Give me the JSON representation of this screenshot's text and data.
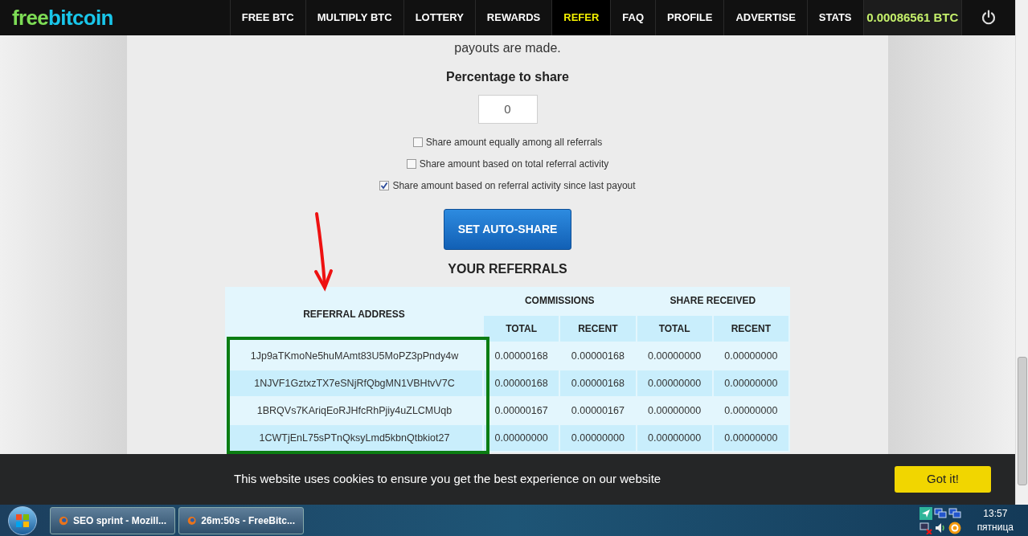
{
  "logo": {
    "part_1": "free",
    "part_2": "bitcoin"
  },
  "nav": [
    {
      "label": "FREE BTC",
      "selected": false
    },
    {
      "label": "MULTIPLY BTC",
      "selected": false
    },
    {
      "label": "LOTTERY",
      "selected": false
    },
    {
      "label": "REWARDS",
      "selected": false
    },
    {
      "label": "REFER",
      "selected": true
    },
    {
      "label": "FAQ",
      "selected": false
    },
    {
      "label": "PROFILE",
      "selected": false
    },
    {
      "label": "ADVERTISE",
      "selected": false
    },
    {
      "label": "STATS",
      "selected": false
    }
  ],
  "balance": "0.00086561 BTC",
  "intro_text": "payouts are made.",
  "percentage": {
    "label": "Percentage to share",
    "value": "0"
  },
  "share_options": [
    {
      "label": "Share amount equally among all referrals",
      "checked": false
    },
    {
      "label": "Share amount based on total referral activity",
      "checked": false
    },
    {
      "label": "Share amount based on referral activity since last payout",
      "checked": true
    }
  ],
  "set_button": "SET AUTO-SHARE",
  "referrals": {
    "title": "YOUR REFERRALS",
    "columns": {
      "address": "REFERRAL ADDRESS",
      "groups": [
        {
          "label": "COMMISSIONS",
          "sub": [
            "TOTAL",
            "RECENT"
          ]
        },
        {
          "label": "SHARE RECEIVED",
          "sub": [
            "TOTAL",
            "RECENT"
          ]
        }
      ]
    },
    "rows": [
      [
        "1Jp9aTKmoNe5huMAmt83U5MoPZ3pPndy4w",
        "0.00000168",
        "0.00000168",
        "0.00000000",
        "0.00000000"
      ],
      [
        "1NJVF1GztxzTX7eSNjRfQbgMN1VBHtvV7C",
        "0.00000168",
        "0.00000168",
        "0.00000000",
        "0.00000000"
      ],
      [
        "1BRQVs7KAriqEoRJHfcRhPjiy4uZLCMUqb",
        "0.00000167",
        "0.00000167",
        "0.00000000",
        "0.00000000"
      ],
      [
        "1CWTjEnL75sPTnQksyLmd5kbnQtbkiot27",
        "0.00000000",
        "0.00000000",
        "0.00000000",
        "0.00000000"
      ]
    ]
  },
  "cookie_bar": {
    "message": "This website uses cookies to ensure you get the best experience on our website",
    "button": "Got it!"
  },
  "taskbar": {
    "windows": [
      "SEO sprint - Mozill...",
      "26m:50s - FreeBitc..."
    ],
    "time": "13:57",
    "day": "пятница"
  }
}
